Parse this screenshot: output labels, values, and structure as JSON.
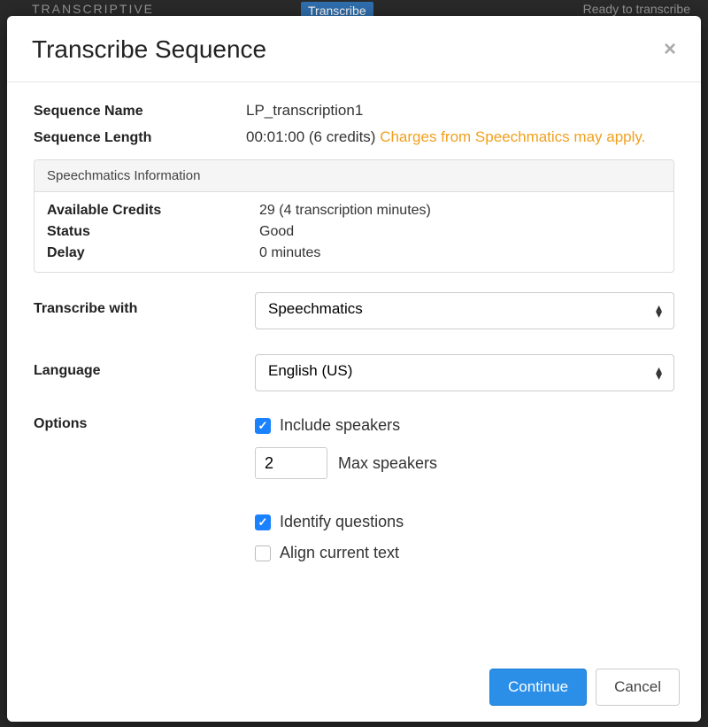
{
  "background": {
    "app_name": "TRANSCRIPTIVE",
    "tab": "Transcribe",
    "status": "Ready to transcribe"
  },
  "modal": {
    "title": "Transcribe Sequence",
    "sequence_name_label": "Sequence Name",
    "sequence_name_value": "LP_transcription1",
    "sequence_length_label": "Sequence Length",
    "sequence_length_value": "00:01:00 (6 credits) ",
    "sequence_length_warn": "Charges from Speechmatics may apply.",
    "panel_title": "Speechmatics Information",
    "credits_label": "Available Credits",
    "credits_value": "29 (4 transcription minutes)",
    "status_label": "Status",
    "status_value": "Good",
    "delay_label": "Delay",
    "delay_value": "0 minutes",
    "transcribe_with_label": "Transcribe with",
    "transcribe_with_value": "Speechmatics",
    "language_label": "Language",
    "language_value": "English (US)",
    "options_label": "Options",
    "include_speakers_label": "Include speakers",
    "max_speakers_value": "2",
    "max_speakers_label": "Max speakers",
    "identify_questions_label": "Identify questions",
    "align_text_label": "Align current text",
    "continue_label": "Continue",
    "cancel_label": "Cancel"
  }
}
